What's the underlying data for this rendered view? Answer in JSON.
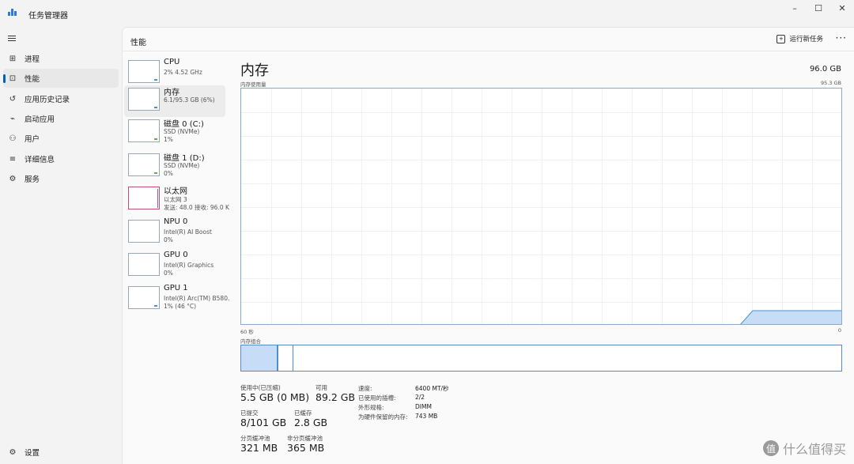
{
  "window": {
    "title": "任务管理器",
    "controls": [
      "–",
      "☐",
      "✕"
    ]
  },
  "nav": {
    "items": [
      {
        "icon": "processes-icon",
        "glyph": "⊞",
        "label": "进程"
      },
      {
        "icon": "performance-icon",
        "glyph": "⊡",
        "label": "性能",
        "active": true
      },
      {
        "icon": "app-history-icon",
        "glyph": "↺",
        "label": "应用历史记录"
      },
      {
        "icon": "startup-apps-icon",
        "glyph": "⌁",
        "label": "启动应用"
      },
      {
        "icon": "users-icon",
        "glyph": "⚇",
        "label": "用户"
      },
      {
        "icon": "details-icon",
        "glyph": "≡",
        "label": "详细信息"
      },
      {
        "icon": "services-icon",
        "glyph": "⚙",
        "label": "服务"
      }
    ],
    "settings_label": "设置",
    "settings_glyph": "⚙"
  },
  "header": {
    "title": "性能",
    "run_new_task": "运行新任务",
    "more": "···"
  },
  "resources": [
    {
      "name": "CPU",
      "sub1": "2% 4.52 GHz",
      "sub2": ""
    },
    {
      "name": "内存",
      "sub1": "6.1/95.3 GB (6%)",
      "sub2": "",
      "active": true
    },
    {
      "name": "磁盘 0 (C:)",
      "sub1": "SSD (NVMe)",
      "sub2": "1%"
    },
    {
      "name": "磁盘 1 (D:)",
      "sub1": "SSD (NVMe)",
      "sub2": "0%"
    },
    {
      "name": "以太网",
      "sub1": "以太网 3",
      "sub2": "发送: 48.0 接收: 96.0 K"
    },
    {
      "name": "NPU 0",
      "sub1": "Intel(R) AI Boost",
      "sub2": "0%"
    },
    {
      "name": "GPU 0",
      "sub1": "Intel(R) Graphics",
      "sub2": "0%"
    },
    {
      "name": "GPU 1",
      "sub1": "Intel(R) Arc(TM) B580.",
      "sub2": "1% (46 °C)"
    }
  ],
  "detail": {
    "title": "内存",
    "capacity": "96.0 GB",
    "usage_label": "内存使用量",
    "usage_max": "95.3 GB",
    "time_left": "60 秒",
    "time_right": "0",
    "composition_label": "内存组合"
  },
  "stats": {
    "in_use_label": "使用中(已压缩)",
    "in_use_value": "5.5 GB (0 MB)",
    "available_label": "可用",
    "available_value": "89.2 GB",
    "committed_label": "已提交",
    "committed_value": "8/101 GB",
    "cached_label": "已缓存",
    "cached_value": "2.8 GB",
    "paged_label": "分页缓冲池",
    "paged_value": "321 MB",
    "nonpaged_label": "非分页缓冲池",
    "nonpaged_value": "365 MB"
  },
  "specs": [
    {
      "key": "速度:",
      "value": "6400 MT/秒"
    },
    {
      "key": "已使用的插槽:",
      "value": "2/2"
    },
    {
      "key": "外形规格:",
      "value": "DIMM"
    },
    {
      "key": "为硬件保留的内存:",
      "value": "743 MB"
    }
  ],
  "watermark": {
    "logo": "值",
    "text": "什么值得买"
  },
  "colors": {
    "accent": "#005fb8",
    "memory_fill": "#c6dcf7",
    "memory_stroke": "#4d8fd6",
    "ethernet": "#c0507a"
  }
}
